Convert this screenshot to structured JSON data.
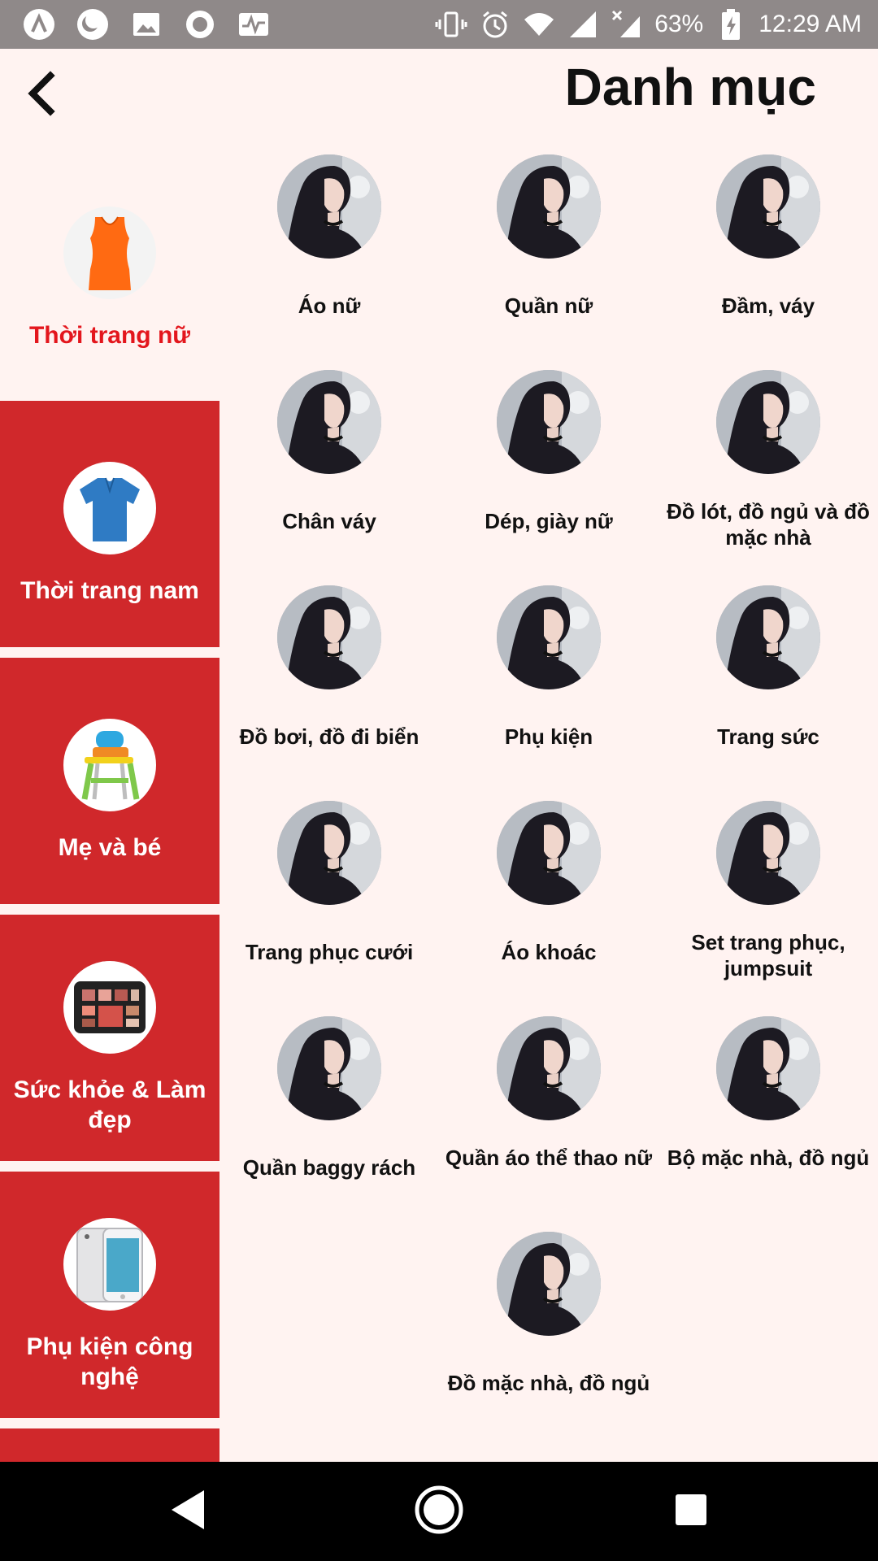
{
  "status_bar": {
    "battery": "63%",
    "time": "12:29 AM",
    "left_icons": [
      "app-icon",
      "night-mode-icon",
      "image-icon",
      "record-icon",
      "pulse-icon"
    ],
    "right_icons": [
      "vibrate-icon",
      "alarm-icon",
      "wifi-icon",
      "signal-icon",
      "signal-no-data-icon",
      "battery-charging-icon"
    ]
  },
  "header": {
    "title": "Danh mục",
    "back_icon": "back-chevron-icon"
  },
  "sidebar": {
    "active_color": "#e3161d",
    "inactive_bg": "#d0282b",
    "items": [
      {
        "label": "Thời trang nữ",
        "icon": "women-top-icon",
        "active": true
      },
      {
        "label": "Thời trang nam",
        "icon": "polo-shirt-icon",
        "active": false
      },
      {
        "label": "Mẹ và bé",
        "icon": "baby-high-chair-icon",
        "active": false
      },
      {
        "label": "Sức khỏe & Làm đẹp",
        "icon": "makeup-palette-icon",
        "active": false
      },
      {
        "label": "Phụ kiện công nghệ",
        "icon": "smartphone-icon",
        "active": false
      }
    ]
  },
  "categories": [
    {
      "label": "Áo nữ"
    },
    {
      "label": "Quần nữ"
    },
    {
      "label": "Đầm, váy"
    },
    {
      "label": "Chân váy"
    },
    {
      "label": "Dép, giày nữ"
    },
    {
      "label": "Đồ lót, đồ ngủ và đồ mặc nhà"
    },
    {
      "label": "Đồ bơi, đồ đi biển"
    },
    {
      "label": "Phụ kiện"
    },
    {
      "label": "Trang sức"
    },
    {
      "label": "Trang phục cưới"
    },
    {
      "label": "Áo khoác"
    },
    {
      "label": "Set trang phục, jumpsuit"
    },
    {
      "label": "Quần baggy rách"
    },
    {
      "label": "Quần áo thể thao nữ"
    },
    {
      "label": "Bộ mặc nhà, đồ ngủ"
    },
    {
      "label": "Đồ mặc nhà, đồ ngủ"
    }
  ],
  "nav_bar": {
    "back": "nav-back-icon",
    "home": "nav-home-icon",
    "recents": "nav-recents-icon"
  }
}
